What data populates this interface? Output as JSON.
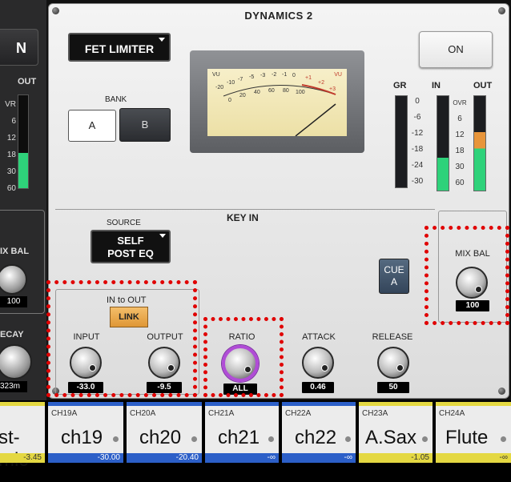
{
  "left_panel": {
    "button_label": "N",
    "out_label": "OUT",
    "scale": [
      "VR",
      "6",
      "12",
      "18",
      "30",
      "60"
    ],
    "meter_level": 0.38,
    "mix_bal_label": "IX BAL",
    "mix_bal_value": "100",
    "decay_label": "ECAY",
    "decay_value": "323m"
  },
  "panel": {
    "title": "DYNAMICS 2",
    "type_selector": "FET LIMITER",
    "on_label": "ON",
    "bank_label": "BANK",
    "bank_a": "A",
    "bank_b": "B"
  },
  "vu": {
    "label_left": "VU",
    "label_right": "VU",
    "top_scale": [
      "-20",
      "-10",
      "-7",
      "-5",
      "-3",
      "-2",
      "-1",
      "0",
      "+1",
      "+2",
      "+3"
    ],
    "bottom_scale": [
      "0",
      "20",
      "40",
      "60",
      "80",
      "100"
    ]
  },
  "meters": {
    "gr_label": "GR",
    "in_label": "IN",
    "out_label": "OUT",
    "gr_scale": [
      "0",
      "-6",
      "-12",
      "-18",
      "-24",
      "-30"
    ],
    "io_scale": [
      "OVR",
      "6",
      "12",
      "18",
      "30",
      "60"
    ],
    "in_level": 0.35,
    "out_level": 0.62,
    "out_peak_color": "#e8953a",
    "meter_color": "#2ed27a"
  },
  "key_in": {
    "title": "KEY IN",
    "source_label": "SOURCE",
    "source_line1": "SELF",
    "source_line2": "POST EQ",
    "cue_line1": "CUE",
    "cue_line2": "A",
    "mix_bal_label": "MIX BAL",
    "mix_bal_value": "100"
  },
  "in_out": {
    "title": "IN to OUT",
    "link_label": "LINK"
  },
  "knobs": {
    "input": {
      "label": "INPUT",
      "value": "-33.0"
    },
    "output": {
      "label": "OUTPUT",
      "value": "-9.5"
    },
    "ratio": {
      "label": "RATIO",
      "value": "ALL"
    },
    "attack": {
      "label": "ATTACK",
      "value": "0.46"
    },
    "release": {
      "label": "RELEASE",
      "value": "50"
    }
  },
  "channels": [
    {
      "id": "",
      "name": "st-mic",
      "foot": "-3.45",
      "color": "yellow"
    },
    {
      "id": "CH19A",
      "name": "ch19",
      "foot": "-30.00",
      "color": "blue"
    },
    {
      "id": "CH20A",
      "name": "ch20",
      "foot": "-20.40",
      "color": "blue"
    },
    {
      "id": "CH21A",
      "name": "ch21",
      "foot": "-∞",
      "color": "blue"
    },
    {
      "id": "CH22A",
      "name": "ch22",
      "foot": "-∞",
      "color": "blue"
    },
    {
      "id": "CH23A",
      "name": "A.Sax",
      "foot": "-1.05",
      "color": "yellow"
    },
    {
      "id": "CH24A",
      "name": "Flute",
      "foot": "-∞",
      "color": "yellow"
    }
  ]
}
